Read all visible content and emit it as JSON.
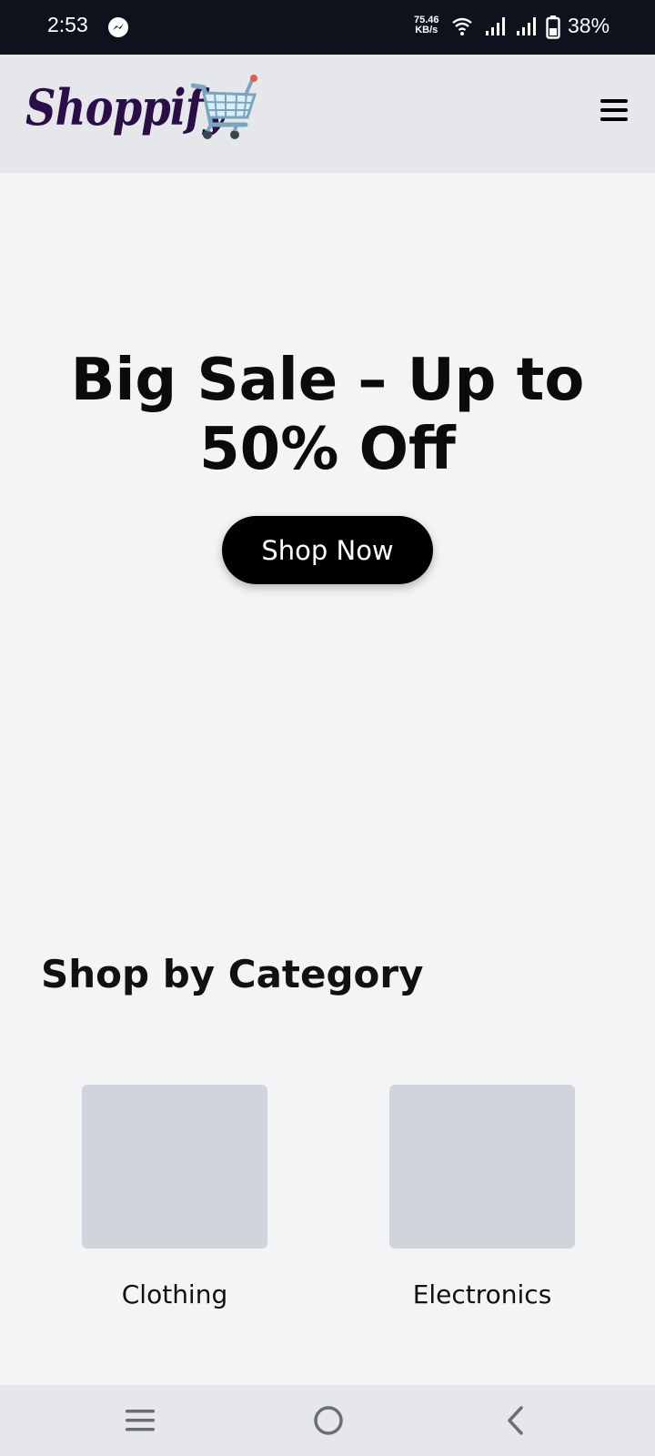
{
  "status_bar": {
    "time": "2:53",
    "speed_value": "75.46",
    "speed_unit": "KB/s",
    "battery": "38%",
    "icons": [
      "messenger-icon",
      "wifi-icon",
      "signal-icon",
      "signal-icon",
      "battery-icon"
    ]
  },
  "header": {
    "logo": "Shoppify",
    "logo_icon": "shopping-cart-icon",
    "menu_icon": "hamburger-menu-icon",
    "colors": {
      "logo": "#2b0e48",
      "background": "#e5e7eb"
    }
  },
  "hero": {
    "title": "Big Sale – Up to 50% Off",
    "cta_label": "Shop Now"
  },
  "categories": {
    "title": "Shop by Category",
    "items": [
      {
        "label": "Clothing"
      },
      {
        "label": "Electronics"
      }
    ]
  },
  "nav_bar": {
    "icons": [
      "recents-icon",
      "home-icon",
      "back-icon"
    ]
  }
}
